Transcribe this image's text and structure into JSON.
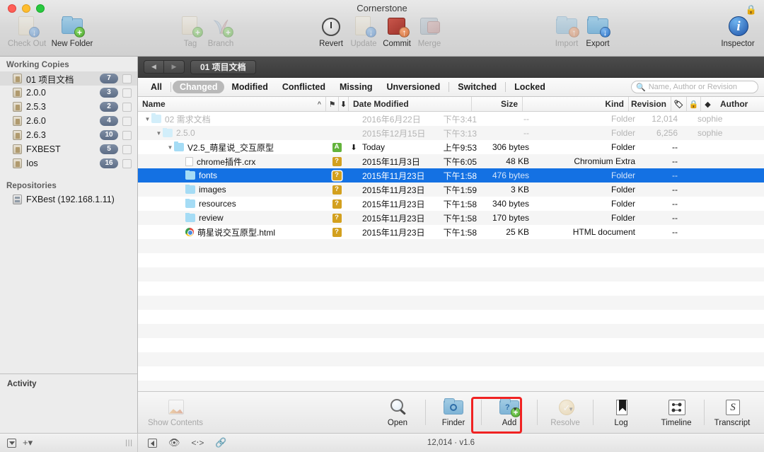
{
  "window": {
    "title": "Cornerstone",
    "traffic_lights": [
      "close-button",
      "minimize-button",
      "zoom-button"
    ],
    "lock_icon": "lock-icon"
  },
  "toolbar": {
    "items": [
      {
        "label": "Check Out",
        "icon": "checkout-icon",
        "enabled": false
      },
      {
        "label": "New Folder",
        "icon": "new-folder-icon",
        "enabled": true
      },
      {
        "label": "Tag",
        "icon": "tag-icon",
        "enabled": false
      },
      {
        "label": "Branch",
        "icon": "branch-icon",
        "enabled": false
      },
      {
        "label": "Revert",
        "icon": "revert-icon",
        "enabled": true
      },
      {
        "label": "Update",
        "icon": "update-icon",
        "enabled": false
      },
      {
        "label": "Commit",
        "icon": "commit-icon",
        "enabled": true
      },
      {
        "label": "Merge",
        "icon": "merge-icon",
        "enabled": false
      },
      {
        "label": "Import",
        "icon": "import-icon",
        "enabled": false
      },
      {
        "label": "Export",
        "icon": "export-icon",
        "enabled": true
      },
      {
        "label": "Inspector",
        "icon": "inspector-icon",
        "enabled": true
      }
    ]
  },
  "sidebar": {
    "working_copies_header": "Working Copies",
    "working_copies": [
      {
        "label": "01 项目文档",
        "badge": "7",
        "selected": true
      },
      {
        "label": "2.0.0",
        "badge": "3",
        "selected": false
      },
      {
        "label": "2.5.3",
        "badge": "2",
        "selected": false
      },
      {
        "label": "2.6.0",
        "badge": "4",
        "selected": false
      },
      {
        "label": "2.6.3",
        "badge": "10",
        "selected": false
      },
      {
        "label": "FXBEST",
        "badge": "5",
        "selected": false
      },
      {
        "label": "Ios",
        "badge": "16",
        "selected": false
      }
    ],
    "repositories_header": "Repositories",
    "repositories": [
      {
        "label": "FXBest (192.168.1.11)"
      }
    ],
    "activity_header": "Activity"
  },
  "navbar": {
    "back_label": "◀",
    "forward_label": "▶",
    "breadcrumb": "01 项目文档"
  },
  "filters": {
    "tabs": [
      {
        "label": "All",
        "active": false
      },
      {
        "label": "Changed",
        "active": true
      },
      {
        "label": "Modified",
        "active": false
      },
      {
        "label": "Conflicted",
        "active": false
      },
      {
        "label": "Missing",
        "active": false
      },
      {
        "label": "Unversioned",
        "active": false
      },
      {
        "label": "Switched",
        "active": false
      },
      {
        "label": "Locked",
        "active": false
      }
    ]
  },
  "search": {
    "placeholder": "Name, Author or Revision",
    "value": "",
    "icon": "search-icon"
  },
  "columns": {
    "name": "Name",
    "sort_indicator": "^",
    "flag": "flag-icon",
    "download": "download-arrow-icon",
    "date_modified": "Date Modified",
    "size": "Size",
    "kind": "Kind",
    "revision": "Revision",
    "tag": "tag-column-icon",
    "lock": "lock-column-icon",
    "layers": "layers-column-icon",
    "author": "Author"
  },
  "files": [
    {
      "name": "02 需求文档",
      "indent": 0,
      "triangle": "▼",
      "icon": "folder-icon",
      "status": "",
      "arrow": "",
      "date": "2016年6月22日",
      "time": "下午3:41",
      "size": "--",
      "kind": "Folder",
      "revision": "12,014",
      "author": "sophie",
      "dim": true,
      "selected": false
    },
    {
      "name": "2.5.0",
      "indent": 1,
      "triangle": "▼",
      "icon": "folder-icon",
      "status": "",
      "arrow": "",
      "date": "2015年12月15日",
      "time": "下午3:13",
      "size": "--",
      "kind": "Folder",
      "revision": "6,256",
      "author": "sophie",
      "dim": true,
      "selected": false
    },
    {
      "name": "V2.5_萌星说_交互原型",
      "indent": 2,
      "triangle": "▼",
      "icon": "folder-icon",
      "status": "A",
      "arrow": "⬇",
      "date": "Today",
      "time": "上午9:53",
      "size": "306 bytes",
      "kind": "Folder",
      "revision": "--",
      "author": "",
      "dim": false,
      "selected": false
    },
    {
      "name": "chrome插件.crx",
      "indent": 3,
      "triangle": "",
      "icon": "document-icon",
      "status": "?",
      "arrow": "",
      "date": "2015年11月3日",
      "time": "下午6:05",
      "size": "48 KB",
      "kind": "Chromium Extra",
      "revision": "--",
      "author": "",
      "dim": false,
      "selected": false
    },
    {
      "name": "fonts",
      "indent": 3,
      "triangle": "",
      "icon": "folder-icon",
      "status": "?",
      "arrow": "",
      "date": "2015年11月23日",
      "time": "下午1:58",
      "size": "476 bytes",
      "kind": "Folder",
      "revision": "--",
      "author": "",
      "dim": false,
      "selected": true
    },
    {
      "name": "images",
      "indent": 3,
      "triangle": "",
      "icon": "folder-icon",
      "status": "?",
      "arrow": "",
      "date": "2015年11月23日",
      "time": "下午1:59",
      "size": "3 KB",
      "kind": "Folder",
      "revision": "--",
      "author": "",
      "dim": false,
      "selected": false
    },
    {
      "name": "resources",
      "indent": 3,
      "triangle": "",
      "icon": "folder-icon",
      "status": "?",
      "arrow": "",
      "date": "2015年11月23日",
      "time": "下午1:58",
      "size": "340 bytes",
      "kind": "Folder",
      "revision": "--",
      "author": "",
      "dim": false,
      "selected": false
    },
    {
      "name": "review",
      "indent": 3,
      "triangle": "",
      "icon": "folder-icon",
      "status": "?",
      "arrow": "",
      "date": "2015年11月23日",
      "time": "下午1:58",
      "size": "170 bytes",
      "kind": "Folder",
      "revision": "--",
      "author": "",
      "dim": false,
      "selected": false
    },
    {
      "name": "萌星说交互原型.html",
      "indent": 3,
      "triangle": "",
      "icon": "chrome-icon",
      "status": "?",
      "arrow": "",
      "date": "2015年11月23日",
      "time": "下午1:58",
      "size": "25 KB",
      "kind": "HTML document",
      "revision": "--",
      "author": "",
      "dim": false,
      "selected": false
    }
  ],
  "actions": [
    {
      "label": "Show Contents",
      "icon": "show-contents-icon",
      "enabled": false,
      "caret": false,
      "highlighted": false
    },
    {
      "label": "Open",
      "icon": "open-magnifier-icon",
      "enabled": true,
      "caret": false,
      "highlighted": false
    },
    {
      "label": "Finder",
      "icon": "finder-icon",
      "enabled": true,
      "caret": false,
      "highlighted": false
    },
    {
      "label": "Add",
      "icon": "add-icon",
      "enabled": true,
      "caret": true,
      "highlighted": true
    },
    {
      "label": "Resolve",
      "icon": "resolve-icon",
      "enabled": false,
      "caret": true,
      "highlighted": false
    },
    {
      "label": "Log",
      "icon": "log-icon",
      "enabled": true,
      "caret": false,
      "highlighted": false
    },
    {
      "label": "Timeline",
      "icon": "timeline-icon",
      "enabled": true,
      "caret": false,
      "highlighted": false
    },
    {
      "label": "Transcript",
      "icon": "transcript-icon",
      "enabled": true,
      "caret": false,
      "highlighted": false
    }
  ],
  "statusbar": {
    "left_icons": [
      "filter-dropdown-icon",
      "add-plus-icon"
    ],
    "grip": "|||",
    "right_icons": [
      "sidebar-toggle-icon",
      "eye-icon",
      "diff-icon",
      "link-icon"
    ],
    "info": "12,014 · v1.6"
  },
  "colors": {
    "selection_blue": "#1471e3",
    "highlight_red": "#f02222",
    "status_added_green": "#63b33b",
    "status_unversioned_orange": "#d3a01e",
    "badge_blue": "#5d6d86"
  }
}
